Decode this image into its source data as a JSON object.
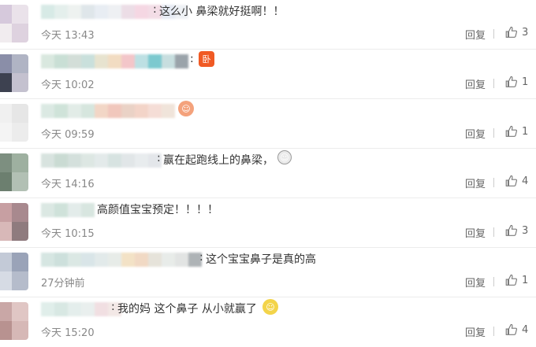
{
  "comments": [
    {
      "text": "这么小 鼻梁就好挺啊！！",
      "time": "今天 13:43",
      "reply": "回复",
      "likes": "3",
      "avatar_colors": [
        "#d6c9dc",
        "#eae2ea",
        "#f1ecef",
        "#ded2df"
      ],
      "name_colors": [
        "#d7eae6",
        "#e4efec",
        "#eef2f0",
        "#dfe6ea",
        "#e8edf3",
        "#eef0f3",
        "#ecdde6",
        "#f5d7e3",
        "#f3dde6",
        "#e5eaf3",
        "#eef1f5"
      ],
      "emoji": "",
      "emoji_color": ""
    },
    {
      "text": "",
      "time": "今天 10:02",
      "reply": "回复",
      "likes": "1",
      "avatar_colors": [
        "#8a8ea8",
        "#b0b4c4",
        "#3d4150",
        "#c4c1cf"
      ],
      "name_colors": [
        "#d9e8df",
        "#c9dfd5",
        "#d3ded8",
        "#c9e0dc",
        "#e7e3cf",
        "#f2dcc2",
        "#f3c6c9",
        "#bde0e3",
        "#7cc9cf",
        "#c7dedf",
        "#9aa3aa"
      ],
      "emoji": "卧",
      "emoji_color": "#f05a24"
    },
    {
      "text": "",
      "time": "今天 09:59",
      "reply": "回复",
      "likes": "1",
      "avatar_colors": [
        "#f0f0f0",
        "#e6e6e6",
        "#f4f4f4",
        "#ececec"
      ],
      "name_colors": [
        "#dbe9e3",
        "#cfe3d9",
        "#e2ece7",
        "#d6e6de",
        "#f2d6c6",
        "#f1c7bc",
        "#ead2c6",
        "#f3d4c8",
        "#f5ddd6",
        "#f0e4da"
      ],
      "emoji": "☺",
      "emoji_color": "#f4a27c"
    },
    {
      "text": "赢在起跑线上的鼻梁，",
      "time": "今天 14:16",
      "reply": "回复",
      "likes": "4",
      "avatar_colors": [
        "#7d8f80",
        "#9eb0a0",
        "#6c7f6f",
        "#b2c0b4"
      ],
      "name_colors": [
        "#d8e3df",
        "#cadbd3",
        "#d4e0dc",
        "#dde7e3",
        "#e3eaea",
        "#d7e3e1",
        "#e1e6e8",
        "#e8ecee",
        "#e3e6ea"
      ],
      "emoji": "☺",
      "emoji_color": "#eaeaea"
    },
    {
      "text": "高颜值宝宝预定！！！！",
      "time": "今天 10:15",
      "reply": "回复",
      "likes": "3",
      "avatar_colors": [
        "#c79fa2",
        "#a8898e",
        "#d8b8b8",
        "#8f7b7e"
      ],
      "name_colors": [
        "#dbe8e3",
        "#cfe2da",
        "#e3ecea",
        "#d8e6e0"
      ],
      "emoji": "",
      "emoji_color": ""
    },
    {
      "text": "这个宝宝鼻子是真的高",
      "time": "27分钟前",
      "reply": "回复",
      "likes": "1",
      "avatar_colors": [
        "#c3cad7",
        "#9aa3b8",
        "#d6dbe4",
        "#b5bccb"
      ],
      "name_colors": [
        "#d6e6e2",
        "#cde0dc",
        "#dbe8e4",
        "#d9e5e8",
        "#e2eaea",
        "#e7ece8",
        "#f3e2c6",
        "#f1d9c4",
        "#e6e3da",
        "#e8ece9",
        "#e2e4e3",
        "#aeb3b6"
      ],
      "emoji": "",
      "emoji_color": ""
    },
    {
      "text": "我的妈 这个鼻子 从小就赢了",
      "time": "今天 15:20",
      "reply": "回复",
      "likes": "4",
      "avatar_colors": [
        "#c9a7a6",
        "#e0c6c4",
        "#b89290",
        "#d6b8b6"
      ],
      "name_colors": [
        "#e0eeea",
        "#d8e8e3",
        "#e4eeec",
        "#e9efee",
        "#f1dfe2",
        "#f3e8e6"
      ],
      "emoji": "☺",
      "emoji_color": "#f3d44a"
    }
  ]
}
